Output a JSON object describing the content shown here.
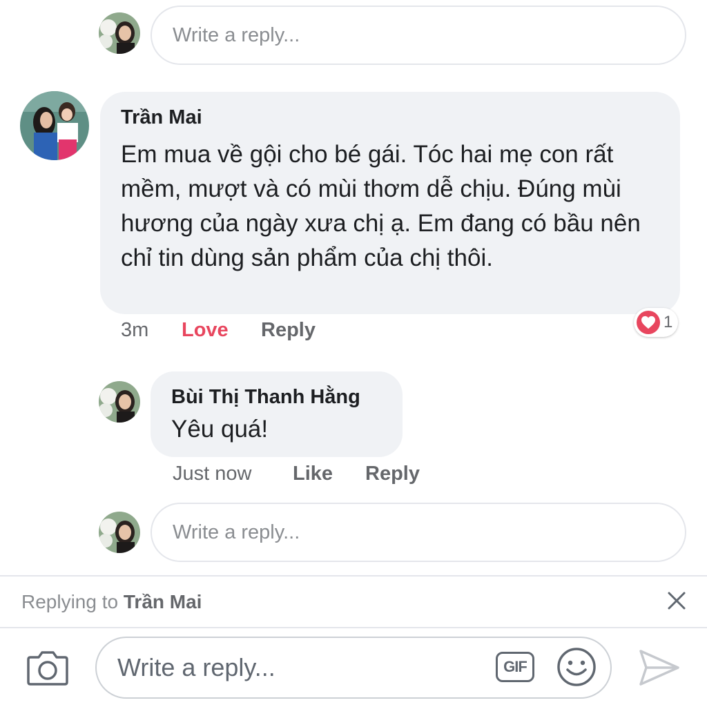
{
  "thread": {
    "top_reply_input": {
      "placeholder": "Write a reply..."
    },
    "comment": {
      "author": "Trần Mai",
      "text": "Em mua về gội cho bé gái. Tóc hai mẹ con rất mềm, mượt và có mùi thơm dễ chịu. Đúng mùi hương của ngày xưa chị ạ. Em đang có bầu nên chỉ tin dùng sản phẩm của chị thôi.",
      "time": "3m",
      "reaction_label": "Love",
      "reply_label": "Reply",
      "reaction_count": "1"
    },
    "reply": {
      "author": "Bùi Thị Thanh Hằng",
      "text": "Yêu quá!",
      "time": "Just now",
      "like_label": "Like",
      "reply_label": "Reply"
    },
    "bottom_reply_input": {
      "placeholder": "Write a reply..."
    }
  },
  "replying_bar": {
    "prefix": "Replying to",
    "name": "Trần Mai"
  },
  "composer": {
    "placeholder": "Write a reply...",
    "gif_label": "GIF",
    "icons": [
      "camera-icon",
      "gif-icon",
      "emoji-icon",
      "send-icon"
    ]
  },
  "colors": {
    "love": "#e8465e",
    "bubble": "#f0f2f5",
    "meta": "#65676b"
  }
}
